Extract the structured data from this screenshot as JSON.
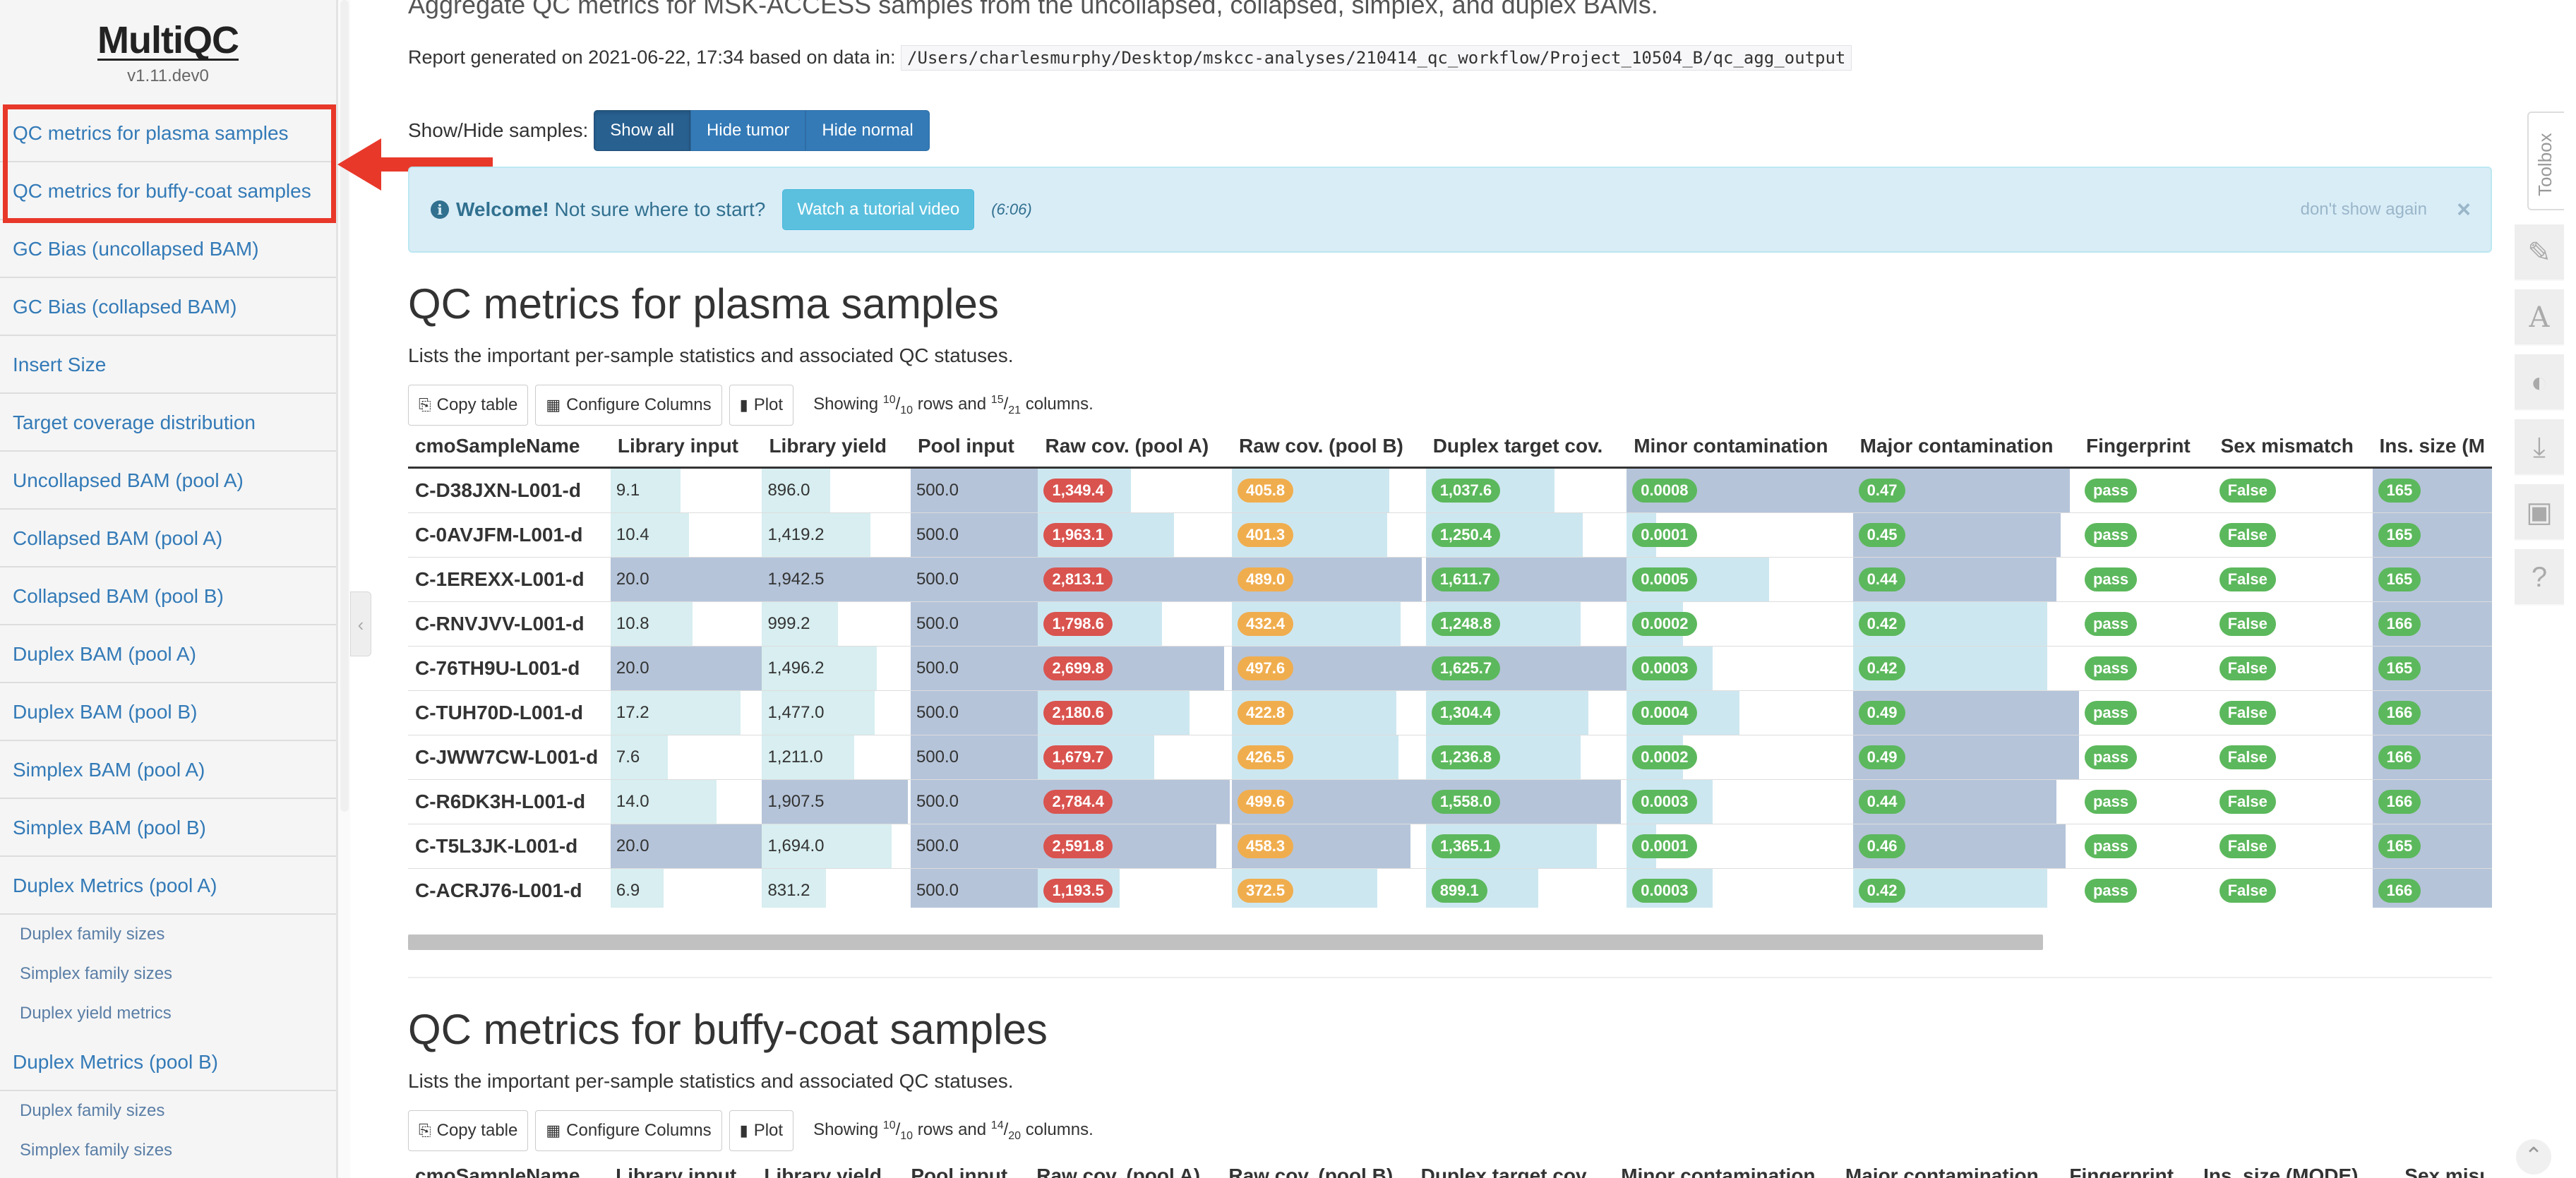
{
  "sidebar": {
    "logo": "MultiQC",
    "version": "v1.11.dev0",
    "items": [
      {
        "label": "QC metrics for plasma samples",
        "type": "main"
      },
      {
        "label": "QC metrics for buffy-coat samples",
        "type": "main"
      },
      {
        "label": "GC Bias (uncollapsed BAM)",
        "type": "main"
      },
      {
        "label": "GC Bias (collapsed BAM)",
        "type": "main"
      },
      {
        "label": "Insert Size",
        "type": "main"
      },
      {
        "label": "Target coverage distribution",
        "type": "main"
      },
      {
        "label": "Uncollapsed BAM (pool A)",
        "type": "main"
      },
      {
        "label": "Collapsed BAM (pool A)",
        "type": "main"
      },
      {
        "label": "Collapsed BAM (pool B)",
        "type": "main"
      },
      {
        "label": "Duplex BAM (pool A)",
        "type": "main"
      },
      {
        "label": "Duplex BAM (pool B)",
        "type": "main"
      },
      {
        "label": "Simplex BAM (pool A)",
        "type": "main"
      },
      {
        "label": "Simplex BAM (pool B)",
        "type": "main"
      },
      {
        "label": "Duplex Metrics (pool A)",
        "type": "main"
      },
      {
        "label": "Duplex family sizes",
        "type": "sub"
      },
      {
        "label": "Simplex family sizes",
        "type": "sub"
      },
      {
        "label": "Duplex yield metrics",
        "type": "sub"
      },
      {
        "label": "Duplex Metrics (pool B)",
        "type": "main"
      },
      {
        "label": "Duplex family sizes",
        "type": "sub"
      },
      {
        "label": "Simplex family sizes",
        "type": "sub"
      }
    ]
  },
  "header": {
    "intro": "Aggregate QC metrics for MSK-ACCESS samples from the uncollapsed, collapsed, simplex, and duplex BAMs.",
    "generated_prefix": "Report generated on 2021-06-22, 17:34 based on data in:",
    "data_path": "/Users/charlesmurphy/Desktop/mskcc-analyses/210414_qc_workflow/Project_10504_B/qc_agg_output",
    "showhide_label": "Show/Hide samples:",
    "show_all": "Show all",
    "hide_tumor": "Hide tumor",
    "hide_normal": "Hide normal"
  },
  "welcome": {
    "icon": "info-circle-icon",
    "bold": "Welcome!",
    "text": "Not sure where to start?",
    "button": "Watch a tutorial video",
    "duration": "(6:06)",
    "dont_show": "don't show again",
    "close": "×"
  },
  "sections": [
    {
      "title": "QC metrics for plasma samples",
      "description": "Lists the important per-sample statistics and associated QC statuses.",
      "toolbar": {
        "copy": "Copy table",
        "configure": "Configure Columns",
        "plot": "Plot",
        "showing_prefix": "Showing",
        "rows_shown": "10",
        "rows_total": "10",
        "rows_word": "rows and",
        "cols_shown": "15",
        "cols_total": "21",
        "cols_word": "columns."
      }
    },
    {
      "title": "QC metrics for buffy-coat samples",
      "description": "Lists the important per-sample statistics and associated QC statuses.",
      "toolbar": {
        "copy": "Copy table",
        "configure": "Configure Columns",
        "plot": "Plot",
        "showing_prefix": "Showing",
        "rows_shown": "10",
        "rows_total": "10",
        "rows_word": "rows and",
        "cols_shown": "14",
        "cols_total": "20",
        "cols_word": "columns."
      },
      "headers": [
        "cmoSampleName",
        "Library input",
        "Library yield",
        "Pool input",
        "Raw cov. (pool A)",
        "Raw cov. (pool B)",
        "Duplex target cov.",
        "Minor contamination",
        "Major contamination",
        "Fingerprint",
        "Ins. size (MODE)",
        "Sex misı"
      ]
    }
  ],
  "plasma_table": {
    "headers": [
      "cmoSampleName",
      "Library input",
      "Library yield",
      "Pool input",
      "Raw cov. (pool A)",
      "Raw cov. (pool B)",
      "Duplex target cov.",
      "Minor contamination",
      "Major contamination",
      "Fingerprint",
      "Sex mismatch",
      "Ins. size (M"
    ],
    "rows": [
      {
        "name": "C-D38JXN-L001-d",
        "lib_input": "9.1",
        "lib_input_frac": 0.46,
        "lib_yield": "896.0",
        "lib_yield_frac": 0.46,
        "pool_input": "500.0",
        "pool_input_frac": 1.0,
        "raw_a": "1,349.4",
        "raw_a_frac": 0.48,
        "raw_b": "405.8",
        "raw_b_frac": 0.81,
        "duplex": "1,037.6",
        "duplex_frac": 0.64,
        "minor": "0.0008",
        "minor_frac": 1.0,
        "major": "0.47",
        "major_frac": 0.96,
        "fingerprint": "pass",
        "sex": "False",
        "ins": "165"
      },
      {
        "name": "C-0AVJFM-L001-d",
        "lib_input": "10.4",
        "lib_input_frac": 0.52,
        "lib_yield": "1,419.2",
        "lib_yield_frac": 0.73,
        "pool_input": "500.0",
        "pool_input_frac": 1.0,
        "raw_a": "1,963.1",
        "raw_a_frac": 0.7,
        "raw_b": "401.3",
        "raw_b_frac": 0.8,
        "duplex": "1,250.4",
        "duplex_frac": 0.78,
        "minor": "0.0001",
        "minor_frac": 0.13,
        "major": "0.45",
        "major_frac": 0.92,
        "fingerprint": "pass",
        "sex": "False",
        "ins": "165"
      },
      {
        "name": "C-1EREXX-L001-d",
        "lib_input": "20.0",
        "lib_input_frac": 1.0,
        "lib_yield": "1,942.5",
        "lib_yield_frac": 1.0,
        "pool_input": "500.0",
        "pool_input_frac": 1.0,
        "raw_a": "2,813.1",
        "raw_a_frac": 1.0,
        "raw_b": "489.0",
        "raw_b_frac": 0.98,
        "duplex": "1,611.7",
        "duplex_frac": 1.0,
        "minor": "0.0005",
        "minor_frac": 0.63,
        "major": "0.44",
        "major_frac": 0.9,
        "fingerprint": "pass",
        "sex": "False",
        "ins": "165"
      },
      {
        "name": "C-RNVJVV-L001-d",
        "lib_input": "10.8",
        "lib_input_frac": 0.54,
        "lib_yield": "999.2",
        "lib_yield_frac": 0.51,
        "pool_input": "500.0",
        "pool_input_frac": 1.0,
        "raw_a": "1,798.6",
        "raw_a_frac": 0.64,
        "raw_b": "432.4",
        "raw_b_frac": 0.87,
        "duplex": "1,248.8",
        "duplex_frac": 0.77,
        "minor": "0.0002",
        "minor_frac": 0.25,
        "major": "0.42",
        "major_frac": 0.86,
        "fingerprint": "pass",
        "sex": "False",
        "ins": "166"
      },
      {
        "name": "C-76TH9U-L001-d",
        "lib_input": "20.0",
        "lib_input_frac": 1.0,
        "lib_yield": "1,496.2",
        "lib_yield_frac": 0.77,
        "pool_input": "500.0",
        "pool_input_frac": 1.0,
        "raw_a": "2,699.8",
        "raw_a_frac": 0.96,
        "raw_b": "497.6",
        "raw_b_frac": 1.0,
        "duplex": "1,625.7",
        "duplex_frac": 1.0,
        "minor": "0.0003",
        "minor_frac": 0.38,
        "major": "0.42",
        "major_frac": 0.86,
        "fingerprint": "pass",
        "sex": "False",
        "ins": "165"
      },
      {
        "name": "C-TUH70D-L001-d",
        "lib_input": "17.2",
        "lib_input_frac": 0.86,
        "lib_yield": "1,477.0",
        "lib_yield_frac": 0.76,
        "pool_input": "500.0",
        "pool_input_frac": 1.0,
        "raw_a": "2,180.6",
        "raw_a_frac": 0.78,
        "raw_b": "422.8",
        "raw_b_frac": 0.85,
        "duplex": "1,304.4",
        "duplex_frac": 0.81,
        "minor": "0.0004",
        "minor_frac": 0.5,
        "major": "0.49",
        "major_frac": 1.0,
        "fingerprint": "pass",
        "sex": "False",
        "ins": "166"
      },
      {
        "name": "C-JWW7CW-L001-d",
        "lib_input": "7.6",
        "lib_input_frac": 0.38,
        "lib_yield": "1,211.0",
        "lib_yield_frac": 0.62,
        "pool_input": "500.0",
        "pool_input_frac": 1.0,
        "raw_a": "1,679.7",
        "raw_a_frac": 0.6,
        "raw_b": "426.5",
        "raw_b_frac": 0.86,
        "duplex": "1,236.8",
        "duplex_frac": 0.77,
        "minor": "0.0002",
        "minor_frac": 0.25,
        "major": "0.49",
        "major_frac": 1.0,
        "fingerprint": "pass",
        "sex": "False",
        "ins": "166"
      },
      {
        "name": "C-R6DK3H-L001-d",
        "lib_input": "14.0",
        "lib_input_frac": 0.7,
        "lib_yield": "1,907.5",
        "lib_yield_frac": 0.98,
        "pool_input": "500.0",
        "pool_input_frac": 1.0,
        "raw_a": "2,784.4",
        "raw_a_frac": 0.99,
        "raw_b": "499.6",
        "raw_b_frac": 1.0,
        "duplex": "1,558.0",
        "duplex_frac": 0.97,
        "minor": "0.0003",
        "minor_frac": 0.38,
        "major": "0.44",
        "major_frac": 0.9,
        "fingerprint": "pass",
        "sex": "False",
        "ins": "166"
      },
      {
        "name": "C-T5L3JK-L001-d",
        "lib_input": "20.0",
        "lib_input_frac": 1.0,
        "lib_yield": "1,694.0",
        "lib_yield_frac": 0.87,
        "pool_input": "500.0",
        "pool_input_frac": 1.0,
        "raw_a": "2,591.8",
        "raw_a_frac": 0.92,
        "raw_b": "458.3",
        "raw_b_frac": 0.92,
        "duplex": "1,365.1",
        "duplex_frac": 0.85,
        "minor": "0.0001",
        "minor_frac": 0.13,
        "major": "0.46",
        "major_frac": 0.94,
        "fingerprint": "pass",
        "sex": "False",
        "ins": "165"
      },
      {
        "name": "C-ACRJ76-L001-d",
        "lib_input": "6.9",
        "lib_input_frac": 0.35,
        "lib_yield": "831.2",
        "lib_yield_frac": 0.43,
        "pool_input": "500.0",
        "pool_input_frac": 1.0,
        "raw_a": "1,193.5",
        "raw_a_frac": 0.42,
        "raw_b": "372.5",
        "raw_b_frac": 0.75,
        "duplex": "899.1",
        "duplex_frac": 0.56,
        "minor": "0.0003",
        "minor_frac": 0.38,
        "major": "0.42",
        "major_frac": 0.86,
        "fingerprint": "pass",
        "sex": "False",
        "ins": "166"
      }
    ]
  },
  "toolbox": {
    "label": "Toolbox",
    "buttons": [
      "pin-icon",
      "font-icon",
      "eye-slash-icon",
      "download-icon",
      "save-icon",
      "help-icon"
    ]
  },
  "colors": {
    "link": "#337ab7",
    "highlight_box": "#e8382a",
    "bar_light": "#cde7f0",
    "bar_dark": "#b5c4d9",
    "label_red": "#d9534f",
    "label_orange": "#f0ad4e",
    "label_green": "#5cb85c"
  }
}
